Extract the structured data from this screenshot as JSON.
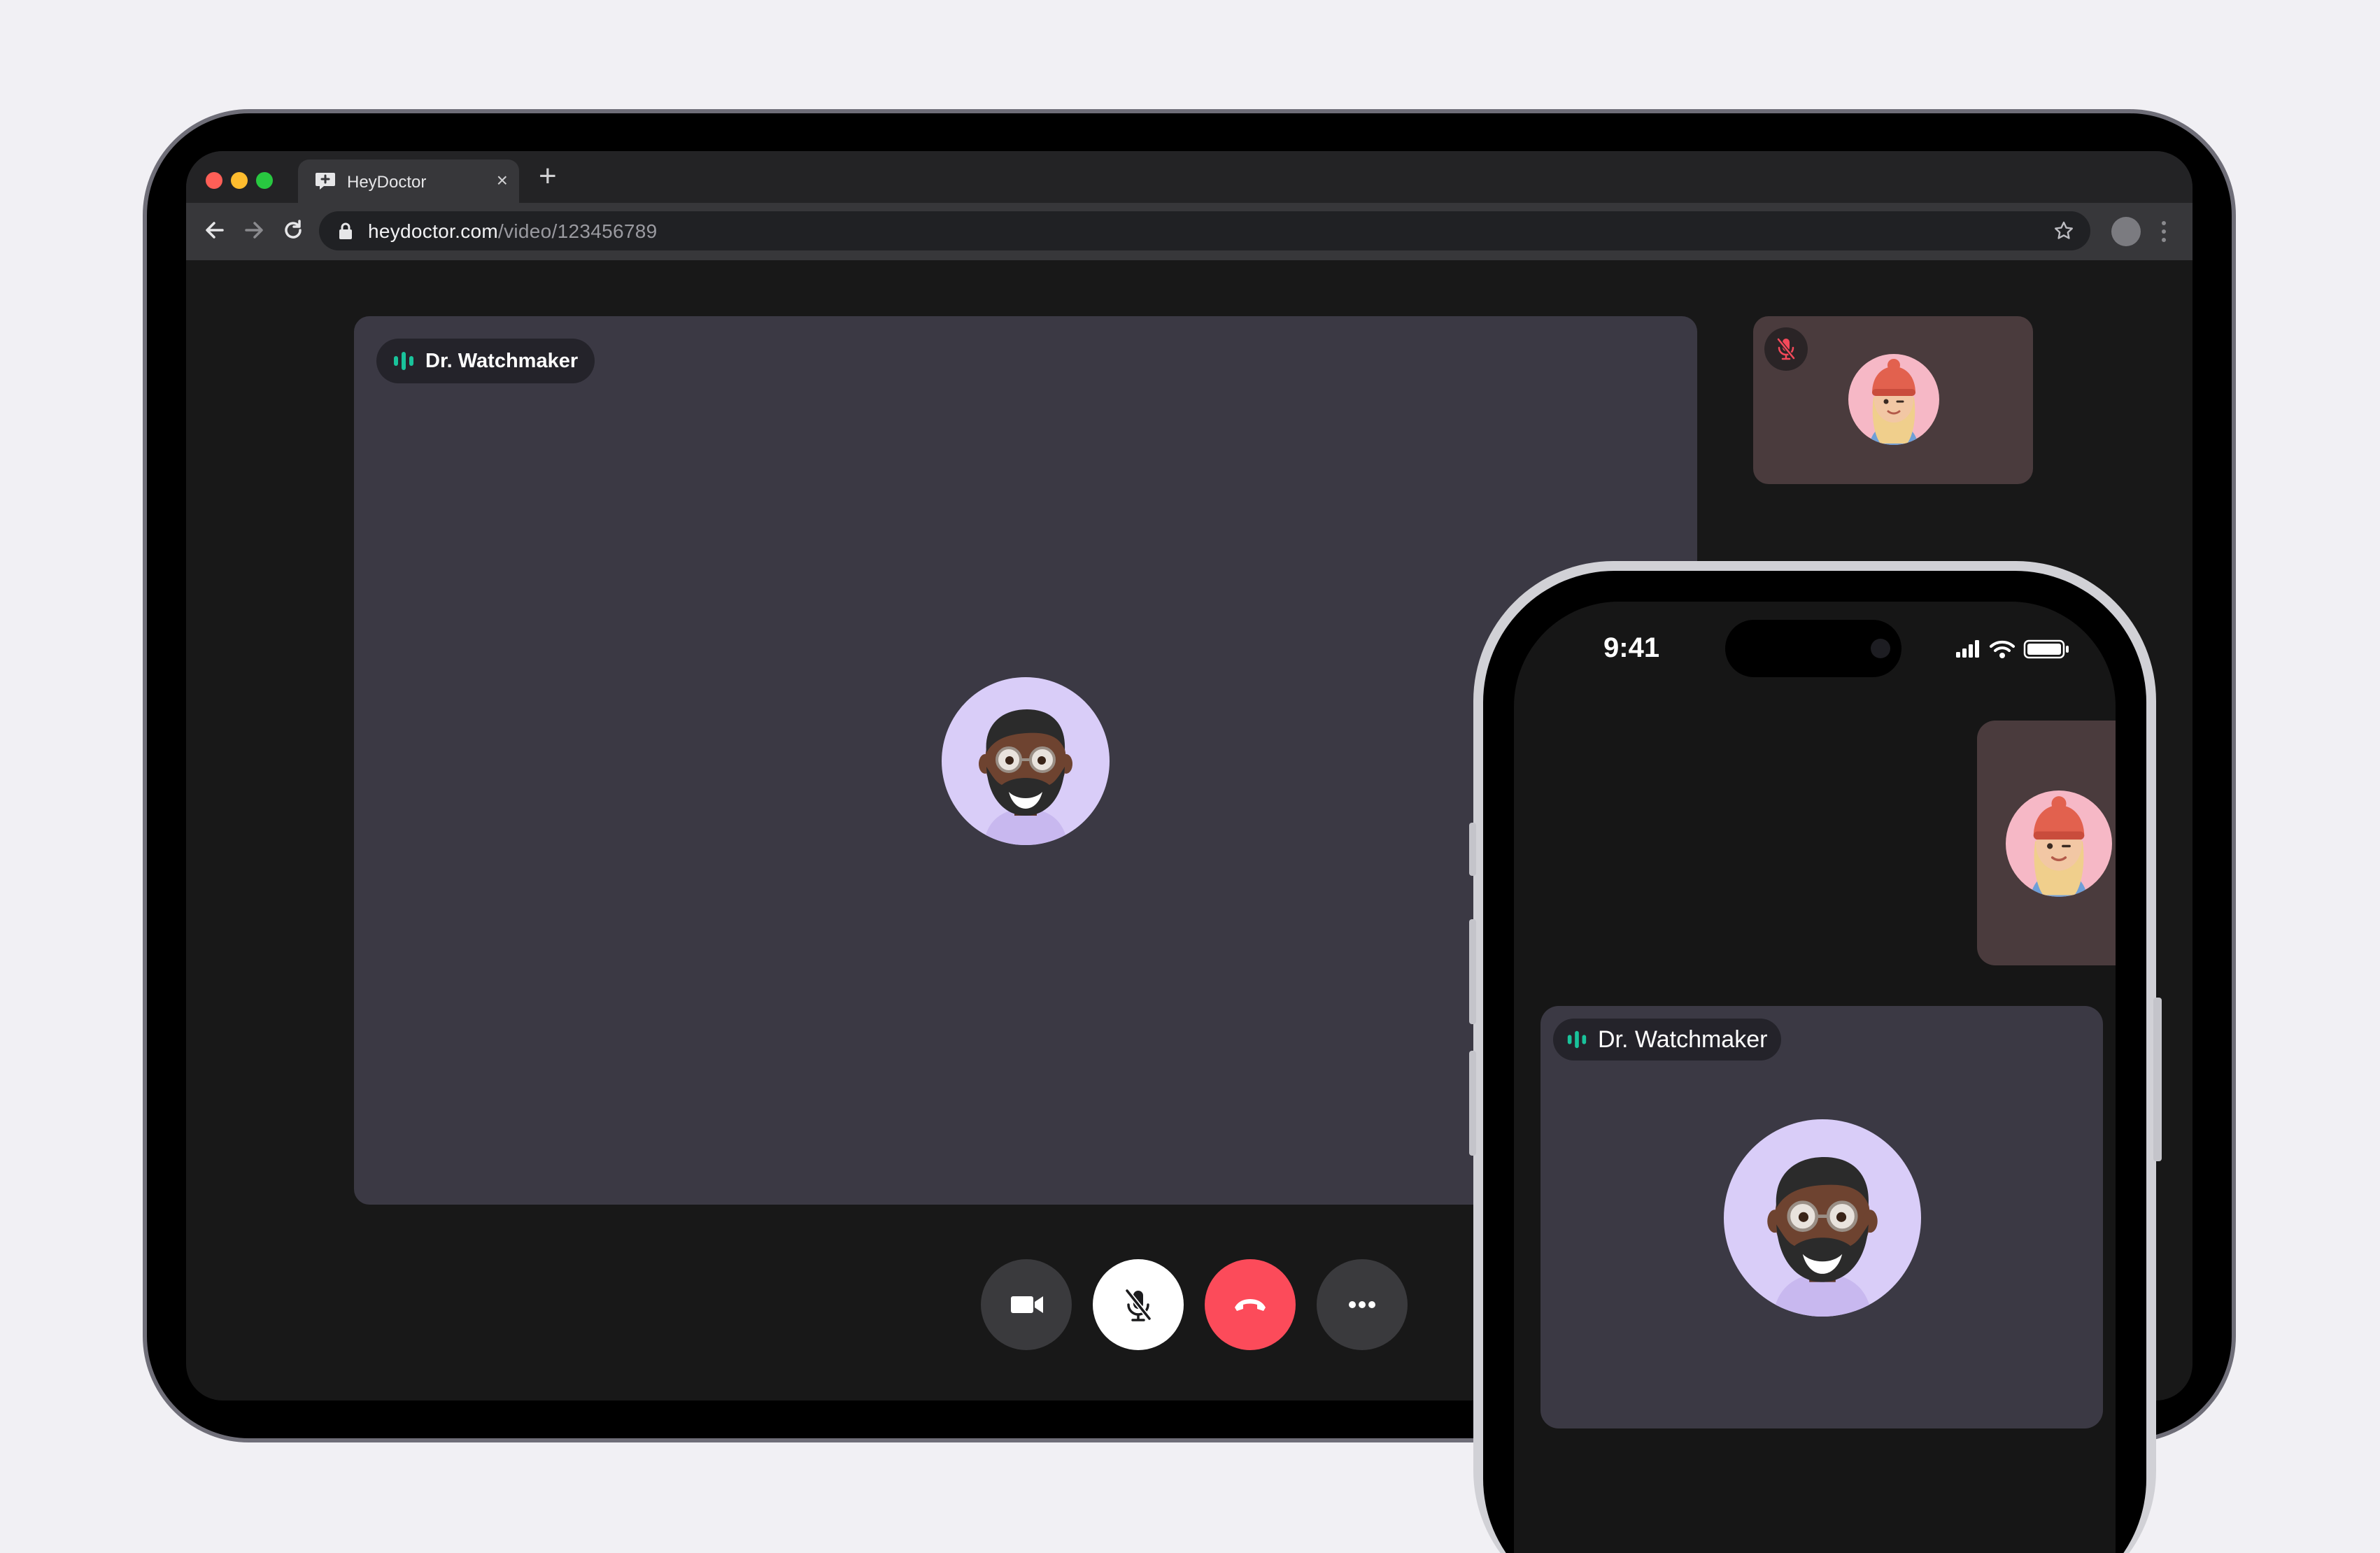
{
  "browser": {
    "tab_title": "HeyDoctor",
    "tab_close": "×",
    "new_tab": "+",
    "url_host": "heydoctor.com",
    "url_path": "/video/123456789"
  },
  "call": {
    "main_participant": "Dr. Watchmaker",
    "self_muted": true,
    "accent_color": "#19c39b",
    "end_call_color": "#fc4b5a",
    "controls": [
      "camera-icon",
      "microphone-off-icon",
      "end-call-icon",
      "more-icon"
    ]
  },
  "phone": {
    "time": "9:41",
    "main_participant": "Dr. Watchmaker"
  }
}
